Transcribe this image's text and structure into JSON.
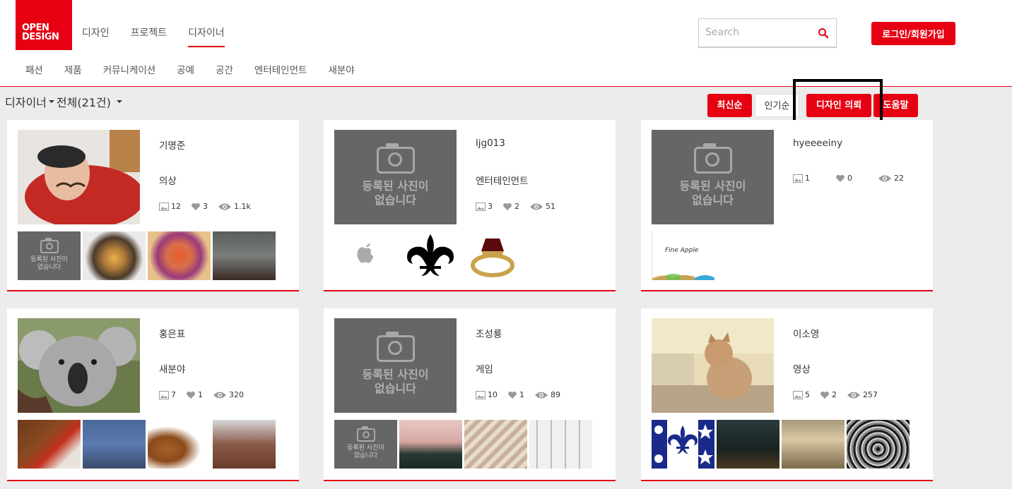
{
  "header": {
    "logo_line1": "OPEN",
    "logo_line2": "DESIGN",
    "main_nav": [
      "디자인",
      "프로젝트",
      "디자이너"
    ],
    "active_nav": "디자이너",
    "sub_nav": [
      "패션",
      "제품",
      "커뮤니케이션",
      "공예",
      "공간",
      "엔터테인먼트",
      "새분야"
    ],
    "search_placeholder": "Search",
    "login_label": "로그인/회원가입"
  },
  "toolbar": {
    "crumb_section": "디자이너",
    "crumb_filter": "전체(21건)",
    "sort_latest": "최신순",
    "sort_popular": "인기순",
    "request_design": "디자인 의뢰",
    "help": "도움말"
  },
  "no_image_text_line1": "등록된 사진이",
  "no_image_text_line2": "없습니다",
  "no_image_small_line1": "등록된 사진이",
  "no_image_small_line2": "없습니다",
  "colors": {
    "accent": "#e60012",
    "background": "#ececec"
  },
  "designers": [
    {
      "name": "기명준",
      "category": "의상",
      "images": "12",
      "likes": "3",
      "views": "1.1k"
    },
    {
      "name": "ljg013",
      "category": "엔터테인먼트",
      "images": "3",
      "likes": "2",
      "views": "51"
    },
    {
      "name": "hyeeeeiny",
      "category": "",
      "images": "1",
      "likes": "0",
      "views": "22"
    },
    {
      "name": "홍은표",
      "category": "새분야",
      "images": "7",
      "likes": "1",
      "views": "320"
    },
    {
      "name": "조성룡",
      "category": "게임",
      "images": "10",
      "likes": "1",
      "views": "89"
    },
    {
      "name": "이소영",
      "category": "영상",
      "images": "5",
      "likes": "2",
      "views": "257"
    }
  ],
  "fine_apple_text": "Fine Apple"
}
